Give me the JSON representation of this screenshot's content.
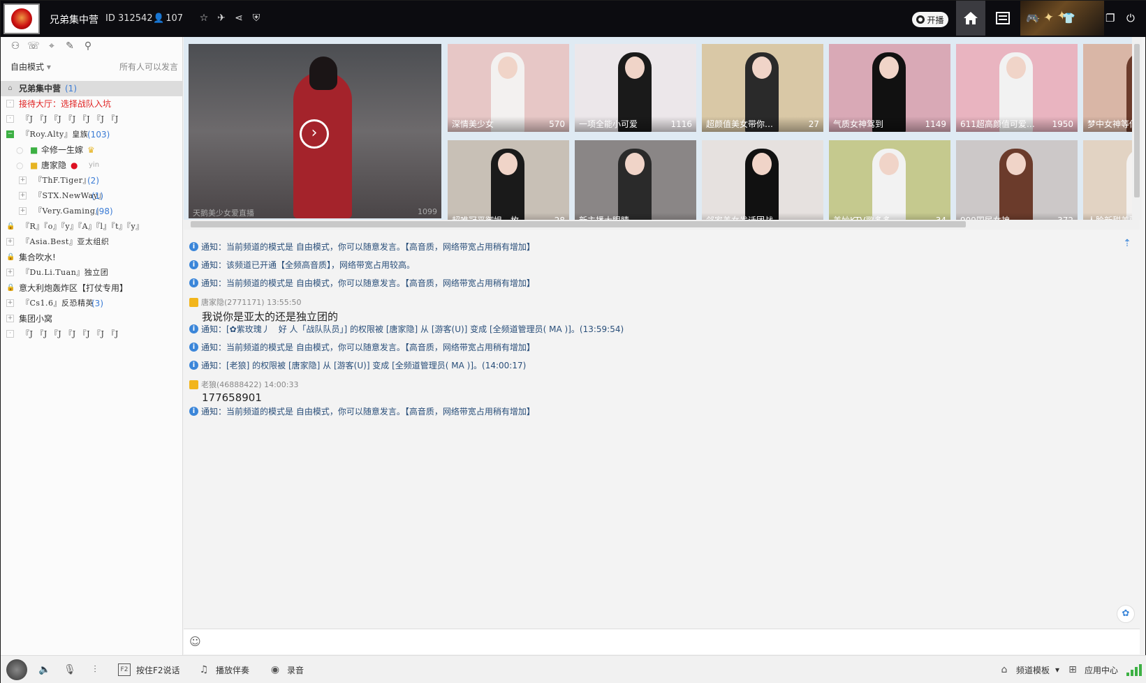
{
  "header": {
    "title": "兄弟集中营",
    "channel_id": "ID 312542",
    "online_count": "107",
    "live_label": "开播"
  },
  "sidebar": {
    "mode_label": "自由模式",
    "permission_label": "所有人可以发言",
    "tree": [
      {
        "label": "兄弟集中营",
        "count": "(1)",
        "kind": "root"
      },
      {
        "label": "接待大厅：选择战队入坑",
        "count": "",
        "kind": "red"
      },
      {
        "label": "『J 『J 『J 『J 『J 『J 『J",
        "count": "",
        "kind": "plain"
      },
      {
        "label": "『Roy.Alty』皇族",
        "count": "(103)",
        "kind": "expanded"
      },
      {
        "label": "伞修一生嫁",
        "count": "",
        "kind": "user1"
      },
      {
        "label": "唐家隐",
        "count": "yin",
        "kind": "user2"
      },
      {
        "label": "『ThF.Tiger』",
        "count": "(2)",
        "kind": "sub"
      },
      {
        "label": "『STX.NewWay』",
        "count": "(1)",
        "kind": "sub"
      },
      {
        "label": "『Very.Gaming』",
        "count": "(98)",
        "kind": "sub"
      },
      {
        "label": "『R』『o』『y』『A』『l』『t』『y』",
        "count": "",
        "kind": "lock"
      },
      {
        "label": "『Asia.Best』亚太组织",
        "count": "",
        "kind": "plain"
      },
      {
        "label": "集合吹水!",
        "count": "",
        "kind": "lock"
      },
      {
        "label": "『Du.Li.Tuan』独立团",
        "count": "",
        "kind": "plain"
      },
      {
        "label": "意大利炮轰炸区【打仗专用】",
        "count": "",
        "kind": "lock"
      },
      {
        "label": "『Cs1.6』反恐精英",
        "count": "(3)",
        "kind": "plain"
      },
      {
        "label": "集团小窝",
        "count": "",
        "kind": "plain"
      },
      {
        "label": "『J 『J 『J 『J 『J 『J 『J",
        "count": "",
        "kind": "plain"
      }
    ]
  },
  "videos": {
    "featured_caption": "天鹅美少女爱直播",
    "featured_count": "1099",
    "tiles": [
      {
        "label": "深情美少女",
        "count": "570",
        "bg": "#e7c7c6"
      },
      {
        "label": "一项全能小可爱",
        "count": "1116",
        "bg": "#ece7ea"
      },
      {
        "label": "超颜值美女带你…",
        "count": "27",
        "bg": "#d9c8a6"
      },
      {
        "label": "气质女神驾到",
        "count": "1149",
        "bg": "#d9a9b6"
      },
      {
        "label": "611超高颜值可爱…",
        "count": "1950",
        "bg": "#e9b4c0"
      },
      {
        "label": "梦中女神等你",
        "count": "",
        "bg": "#d9b6a6"
      },
      {
        "label": "超唯冠平御姐一枚",
        "count": "28",
        "bg": "#c8c0b6"
      },
      {
        "label": "新主播大眼睛",
        "count": "",
        "bg": "#8a8686"
      },
      {
        "label": "邻家美女发话团战",
        "count": "",
        "bg": "#e6e1df"
      },
      {
        "label": "美妙KTV歌多多",
        "count": "34",
        "bg": "#c5c98e"
      },
      {
        "label": "909国民女神",
        "count": "372",
        "bg": "#ccc8c8"
      },
      {
        "label": "人脸新甜美要",
        "count": "",
        "bg": "#e2d3c3"
      }
    ]
  },
  "chat": {
    "messages": [
      {
        "type": "notice",
        "text": "通知：当前频道的模式是 自由模式，你可以随意发言。【高音质，网络带宽占用稍有增加】"
      },
      {
        "type": "notice",
        "text": "通知：该频道已开通【全频高音质】，网络带宽占用较高。"
      },
      {
        "type": "notice",
        "text": "通知：当前频道的模式是 自由模式，你可以随意发言。【高音质，网络带宽占用稍有增加】"
      },
      {
        "type": "sender",
        "text": "唐家隐(2771171) 13:55:50"
      },
      {
        "type": "body",
        "text": "我说你是亚太的还是独立团的"
      },
      {
        "type": "notice",
        "text": "通知：[✿紫玫瑰丿　好 人「战队队员」] 的权限被 [唐家隐] 从 [游客(U)] 变成 [全频道管理员( MA )]。(13:59:54)"
      },
      {
        "type": "notice",
        "text": "通知：当前频道的模式是 自由模式，你可以随意发言。【高音质，网络带宽占用稍有增加】"
      },
      {
        "type": "notice",
        "text": "通知：[老狼] 的权限被 [唐家隐] 从 [游客(U)] 变成 [全频道管理员( MA )]。(14:00:17)"
      },
      {
        "type": "sender",
        "text": "老狼(46888422) 14:00:33"
      },
      {
        "type": "body",
        "text": "177658901"
      },
      {
        "type": "notice",
        "text": "通知：当前频道的模式是 自由模式，你可以随意发言。【高音质，网络带宽占用稍有增加】"
      }
    ]
  },
  "toolbar": {
    "push_to_talk": "按住F2说话",
    "play_music": "播放伴奏",
    "record": "录音",
    "channel_template": "频道模板",
    "app_center": "应用中心",
    "f2_key": "F2"
  }
}
